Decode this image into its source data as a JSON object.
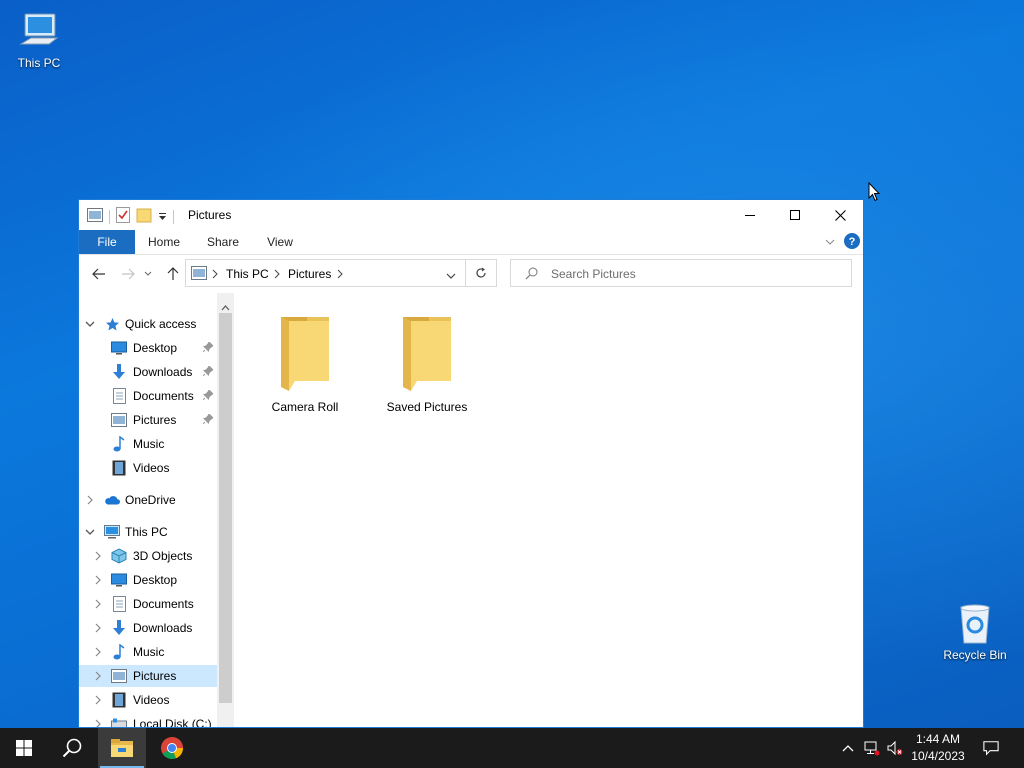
{
  "desktop": {
    "icons": [
      {
        "label": "This PC"
      },
      {
        "label": "Recycle Bin"
      }
    ]
  },
  "window": {
    "title": "Pictures",
    "ribbon_tabs": [
      "File",
      "Home",
      "Share",
      "View"
    ],
    "address": {
      "crumbs": [
        "This PC",
        "Pictures"
      ]
    },
    "search": {
      "placeholder": "Search Pictures"
    },
    "nav_tree": [
      {
        "label": "Quick access",
        "icon": "star-icon",
        "expand": "expanded",
        "pinned": false
      },
      {
        "label": "Desktop",
        "icon": "desktop-icon",
        "expand": "none",
        "pinned": true
      },
      {
        "label": "Downloads",
        "icon": "download-arrow-icon",
        "expand": "none",
        "pinned": true
      },
      {
        "label": "Documents",
        "icon": "document-icon",
        "expand": "none",
        "pinned": true
      },
      {
        "label": "Pictures",
        "icon": "pictures-icon",
        "expand": "none",
        "pinned": true
      },
      {
        "label": "Music",
        "icon": "music-note-icon",
        "expand": "none",
        "pinned": false
      },
      {
        "label": "Videos",
        "icon": "film-strip-icon",
        "expand": "none",
        "pinned": false
      },
      {
        "label": "OneDrive",
        "icon": "cloud-icon",
        "expand": "collapsed",
        "pinned": false
      },
      {
        "label": "This PC",
        "icon": "computer-icon",
        "expand": "expanded",
        "pinned": false
      },
      {
        "label": "3D Objects",
        "icon": "cube-icon",
        "expand": "collapsed",
        "pinned": false
      },
      {
        "label": "Desktop",
        "icon": "desktop-icon",
        "expand": "collapsed",
        "pinned": false
      },
      {
        "label": "Documents",
        "icon": "document-icon",
        "expand": "collapsed",
        "pinned": false
      },
      {
        "label": "Downloads",
        "icon": "download-arrow-icon",
        "expand": "collapsed",
        "pinned": false
      },
      {
        "label": "Music",
        "icon": "music-note-icon",
        "expand": "collapsed",
        "pinned": false
      },
      {
        "label": "Pictures",
        "icon": "pictures-icon",
        "expand": "collapsed",
        "pinned": false,
        "selected": true
      },
      {
        "label": "Videos",
        "icon": "film-strip-icon",
        "expand": "collapsed",
        "pinned": false
      },
      {
        "label": "Local Disk (C:)",
        "icon": "drive-icon",
        "expand": "collapsed",
        "pinned": false
      }
    ],
    "items": [
      {
        "label": "Camera Roll",
        "icon": "folder-icon"
      },
      {
        "label": "Saved Pictures",
        "icon": "folder-icon"
      }
    ]
  },
  "taskbar": {
    "time": "1:44 AM",
    "date": "10/4/2023"
  },
  "colors": {
    "accent": "#1a6dc0",
    "selection": "#cce8ff",
    "taskbar": "#1b1b1b",
    "folder": "#f8d775"
  }
}
